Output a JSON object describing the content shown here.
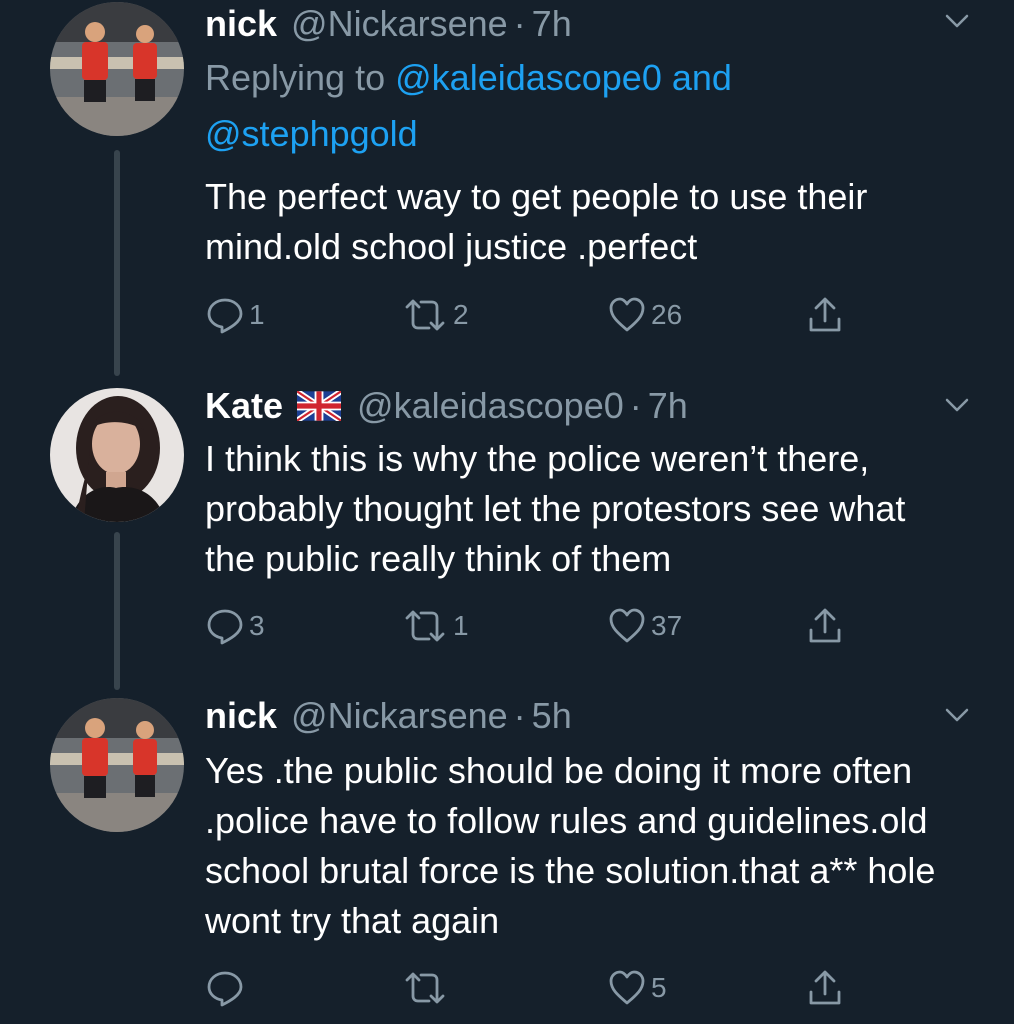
{
  "tweets": [
    {
      "name": "nick",
      "handle": "@Nickarsene",
      "time": "7h",
      "replying_prefix": "Replying to",
      "replying_mention1": "@kaleidascope0",
      "replying_and": "and",
      "replying_mention2": "@stephpgold",
      "text": "The perfect way to get people to use their mind.old school justice .perfect",
      "replies": "1",
      "retweets": "2",
      "likes": "26"
    },
    {
      "name": "Kate",
      "flag_icon": "uk-flag-icon",
      "handle": "@kaleidascope0",
      "time": "7h",
      "text": "I think this is why the police weren’t there, probably thought let the protestors see what the public really think of them",
      "replies": "3",
      "retweets": "1",
      "likes": "37"
    },
    {
      "name": "nick",
      "handle": "@Nickarsene",
      "time": "5h",
      "text": "Yes .the public should be doing it more often .police have to follow rules and guidelines.old school brutal force is the solution.that a** hole wont try that again",
      "replies": "",
      "retweets": "",
      "likes": "5"
    }
  ],
  "separator": "·",
  "colors": {
    "background": "#15202b",
    "text": "#ffffff",
    "muted": "#8899a6",
    "link": "#1da1f2",
    "thread_line": "#38444d"
  }
}
